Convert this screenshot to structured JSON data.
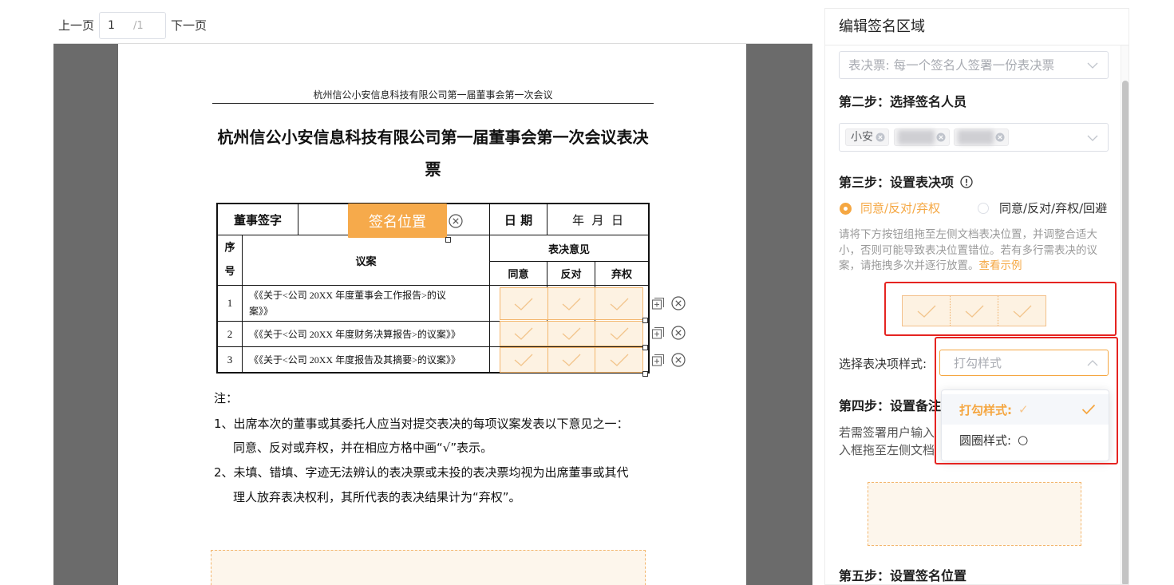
{
  "viewer": {
    "prev_label": "上一页",
    "page_input_value": "1",
    "page_total": "/1",
    "next_label": "下一页"
  },
  "document": {
    "running_header": "杭州信公小安信息科技有限公司第一届董事会第一次会议",
    "title_line_1": "杭州信公小安信息科技有限公司第一届董事会第一次会议表决",
    "title_line_2": "票",
    "table": {
      "signature_label": "董事签字",
      "date_label": "日 期",
      "date_value": "年  月  日",
      "seq_header": [
        "序",
        "号"
      ],
      "proposal_header": "议案",
      "opinion_header": "表决意见",
      "opinion_columns": [
        "同意",
        "反对",
        "弃权"
      ],
      "rows": [
        {
          "no": "1",
          "proposal_lines": [
            "《《关于<公司 20XX 年度董事会工作报告>的议",
            "案》》"
          ]
        },
        {
          "no": "2",
          "proposal_lines": [
            "《《关于<公司 20XX 年度财务决算报告>的议案》》"
          ]
        },
        {
          "no": "3",
          "proposal_lines": [
            "《《关于<公司 20XX 年度报告及其摘要>的议案》》"
          ]
        }
      ]
    },
    "notes_heading": "注：",
    "notes_lines": [
      "1、出席本次的董事或其委托人应当对提交表决的每项议案发表以下意见之一：",
      "同意、反对或弃权，并在相应方格中画“√”表示。",
      "2、未填、错填、字迹无法辨认的表决票或未投的表决票均视为出席董事或其代",
      "理人放弃表决权利，其所代表的表决结果计为“弃权”。"
    ]
  },
  "overlays": {
    "signature_position_label": "签名位置"
  },
  "panel": {
    "title": "编辑签名区域",
    "ballot_mode_placeholder": "表决票: 每一个签名人签署一份表决票",
    "step2_title": "第二步：选择签名人员",
    "signer_tags": [
      {
        "label": "小安"
      }
    ],
    "step3_title": "第三步：设置表决项",
    "vote_options": [
      {
        "label": "同意/反对/弃权",
        "selected": true
      },
      {
        "label": "同意/反对/弃权/回避",
        "selected": false
      }
    ],
    "step3_help_lines": [
      "请将下方按钮组拖至左侧文档表决位置，并调整合适大",
      "小，否则可能导致表决位置错位。若有多行需表决的议",
      "案，请拖拽多次并逐行放置。"
    ],
    "step3_help_link": "查看示例",
    "style_label": "选择表决项样式:",
    "style_placeholder": "打勾样式",
    "style_options": [
      {
        "label": "打勾样式:",
        "symbol": "✓",
        "selected": true
      },
      {
        "label": "圆圈样式:",
        "symbol": "○",
        "selected": false
      }
    ],
    "step4_title": "第四步：设置备注",
    "step4_help_lines": [
      "若需签署用户输入",
      "入框拖至左侧文档"
    ],
    "step5_title": "第五步：设置签名位置"
  },
  "colors": {
    "accent": "#f5a742",
    "highlight_frame": "#e52421",
    "cell_fill": "#fdf2e2",
    "viewer_background": "#6b6b6b"
  }
}
